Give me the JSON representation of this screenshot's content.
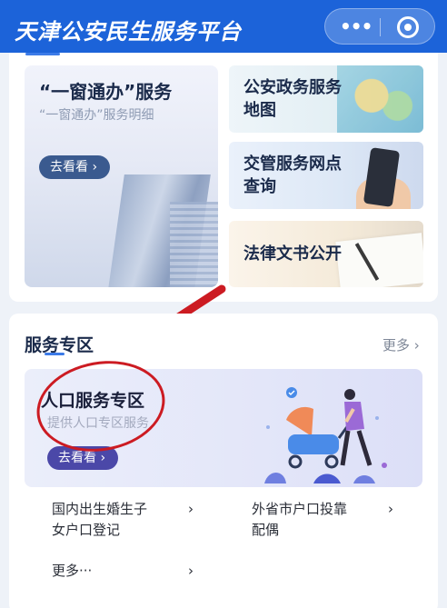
{
  "header": {
    "title": "天津公安民生服务平台",
    "capsule_more": "•••",
    "capsule_target_icon": "target-icon"
  },
  "featured": {
    "title": "“一窗通办”服务",
    "subtitle": "“一窗通办”服务明细",
    "button": "去看看 ›"
  },
  "tiles": [
    {
      "label": "公安政务服务地图",
      "line1": "公安政务服务",
      "line2": "地图"
    },
    {
      "label": "交管服务网点查询",
      "line1": "交管服务网点",
      "line2": "查询"
    },
    {
      "label": "法律文书公开",
      "line1": "法律文书公开",
      "line2": ""
    }
  ],
  "service_zone": {
    "title": "服务专区",
    "more": "更多 ›",
    "banner": {
      "title": "人口服务专区",
      "subtitle": "提供人口专区服务",
      "button": "去看看 ›"
    },
    "links": [
      {
        "line1": "国内出生婚生子",
        "line2": "女户口登记"
      },
      {
        "line1": "外省市户口投靠",
        "line2": "配偶"
      },
      {
        "line1": "更多···",
        "line2": ""
      }
    ],
    "chevron": "›"
  },
  "colors": {
    "header": "#1c63d9",
    "accent": "#3c7be8",
    "annotation": "#cc1b22",
    "zone_button": "#4b48a8"
  }
}
